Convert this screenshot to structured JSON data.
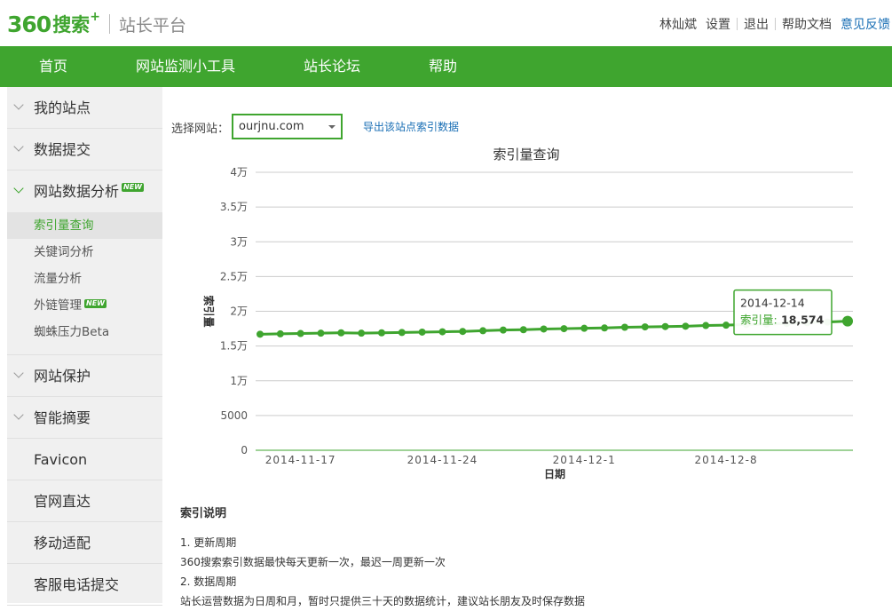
{
  "header": {
    "logo_360": "360",
    "logo_search": "搜索",
    "logo_plus": "+",
    "logo_sub": "站长平台",
    "user_name": "林灿斌",
    "settings": "设置",
    "logout": "退出",
    "help_docs": "帮助文档",
    "feedback": "意见反馈"
  },
  "nav": {
    "items": [
      "首页",
      "网站监测小工具",
      "站长论坛",
      "帮助"
    ]
  },
  "sidebar": {
    "groups": [
      {
        "label": "我的站点"
      },
      {
        "label": "数据提交"
      },
      {
        "label": "网站数据分析",
        "badge": "NEW"
      }
    ],
    "sub_items": [
      {
        "label": "索引量查询"
      },
      {
        "label": "关键词分析"
      },
      {
        "label": "流量分析"
      },
      {
        "label": "外链管理",
        "badge": "NEW"
      },
      {
        "label": "蜘蛛压力Beta"
      }
    ],
    "bottom_groups": [
      {
        "label": "网站保护"
      },
      {
        "label": "智能摘要"
      },
      {
        "label": "Favicon"
      },
      {
        "label": "官网直达"
      },
      {
        "label": "移动适配"
      },
      {
        "label": "客服电话提交"
      }
    ]
  },
  "main": {
    "select_label": "选择网站：",
    "site_value": "ourjnu.com",
    "export_link": "导出该站点索引数据"
  },
  "chart_data": {
    "type": "line",
    "title": "索引量查询",
    "xlabel": "日期",
    "ylabel": "索引量",
    "ylim": [
      0,
      40000
    ],
    "y_ticks": [
      "0",
      "5000",
      "1万",
      "1.5万",
      "2万",
      "2.5万",
      "3万",
      "3.5万",
      "4万"
    ],
    "x_tick_labels": [
      "2014-11-17",
      "2014-11-24",
      "2014-12-1",
      "2014-12-8"
    ],
    "x": [
      "2014-11-15",
      "2014-11-16",
      "2014-11-17",
      "2014-11-18",
      "2014-11-19",
      "2014-11-20",
      "2014-11-21",
      "2014-11-22",
      "2014-11-23",
      "2014-11-24",
      "2014-11-25",
      "2014-11-26",
      "2014-11-27",
      "2014-11-28",
      "2014-11-29",
      "2014-11-30",
      "2014-12-1",
      "2014-12-2",
      "2014-12-3",
      "2014-12-4",
      "2014-12-5",
      "2014-12-6",
      "2014-12-7",
      "2014-12-8",
      "2014-12-9",
      "2014-12-10",
      "2014-12-11",
      "2014-12-12",
      "2014-12-13",
      "2014-12-14"
    ],
    "series": [
      {
        "name": "索引量",
        "color": "#3fa52f",
        "values": [
          16700,
          16750,
          16800,
          16850,
          16900,
          16850,
          16900,
          16950,
          17000,
          17050,
          17100,
          17200,
          17300,
          17350,
          17450,
          17500,
          17550,
          17600,
          17700,
          17750,
          17800,
          17850,
          17950,
          18000,
          18100,
          18150,
          18250,
          18350,
          18450,
          18574
        ]
      }
    ],
    "tooltip": {
      "date": "2014-12-14",
      "label": "索引量:",
      "value": "18,574"
    },
    "grid": true
  },
  "explain": {
    "title": "索引说明",
    "item1_title": "1.  更新周期",
    "item1_text": "360搜索索引数据最快每天更新一次，最迟一周更新一次",
    "item2_title": "2.  数据周期",
    "item2_text": "站长运营数据为日周和月，暂时只提供三十天的数据统计，建议站长朋友及时保存数据"
  }
}
